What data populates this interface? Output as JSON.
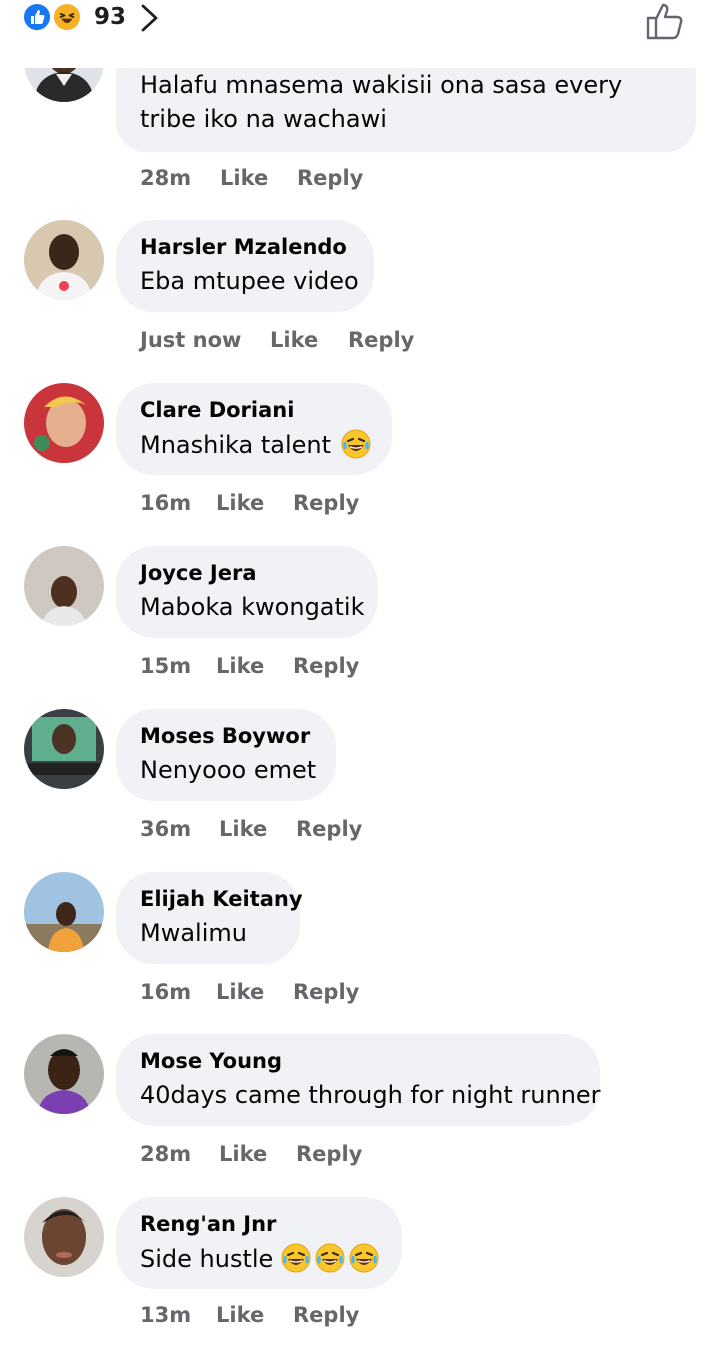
{
  "header": {
    "reaction_count": "93",
    "reactions": [
      "like-icon",
      "haha-icon"
    ],
    "colors": {
      "like": "#1877f2",
      "haha": "#f7b125",
      "bubble": "#f0f2f5",
      "meta": "#65676b"
    }
  },
  "first_comment": {
    "text": "Halafu mnasema wakisii ona sasa every tribe iko na wachawi",
    "time": "28m",
    "like_label": "Like",
    "reply_label": "Reply"
  },
  "comments": [
    {
      "name": "Harsler Mzalendo",
      "text": "Eba mtupee video",
      "time": "Just now",
      "like_label": "Like",
      "reply_label": "Reply"
    },
    {
      "name": "Clare Doriani",
      "text": "Mnashika talent",
      "emoji_count": 1,
      "time": "16m",
      "like_label": "Like",
      "reply_label": "Reply"
    },
    {
      "name": "Joyce Jera",
      "text": "Maboka kwongatik",
      "time": "15m",
      "like_label": "Like",
      "reply_label": "Reply"
    },
    {
      "name": "Moses Boywor",
      "text": "Nenyooo emet",
      "time": "36m",
      "like_label": "Like",
      "reply_label": "Reply"
    },
    {
      "name": "Elijah Keitany",
      "text": "Mwalimu",
      "time": "16m",
      "like_label": "Like",
      "reply_label": "Reply"
    },
    {
      "name": "Mose Young",
      "text": "40days came through for night runner",
      "time": "28m",
      "like_label": "Like",
      "reply_label": "Reply"
    },
    {
      "name": "Reng'an Jnr",
      "text": "Side hustle",
      "emoji_count": 3,
      "time": "13m",
      "like_label": "Like",
      "reply_label": "Reply"
    }
  ]
}
